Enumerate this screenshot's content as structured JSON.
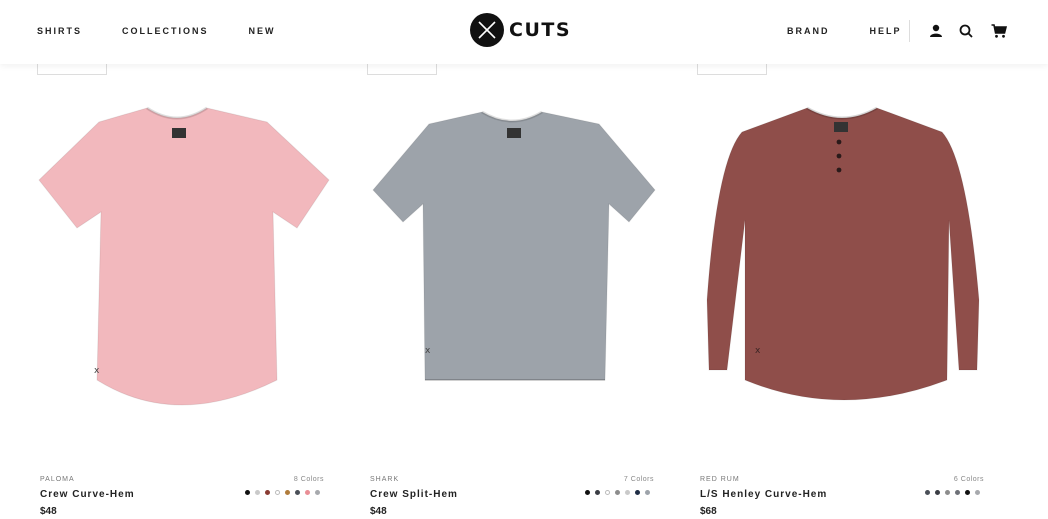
{
  "header": {
    "nav_left": [
      "SHIRTS",
      "COLLECTIONS",
      "NEW"
    ],
    "logo_text": "CUTS",
    "nav_right": [
      "BRAND",
      "HELP"
    ],
    "icons": [
      "account-icon",
      "search-icon",
      "cart-icon"
    ]
  },
  "products": [
    {
      "color_name": "PALOMA",
      "colors_count": "8 Colors",
      "name": "Crew Curve-Hem",
      "price": "$48",
      "shirt_color": "#f2b8bd",
      "style": "tee-curve",
      "swatches": [
        "#111111",
        "#c9c9c9",
        "#8a3b33",
        "#ffffff",
        "#b07c3c",
        "#4a4f57",
        "#e98e95",
        "#a7a9ad"
      ]
    },
    {
      "color_name": "SHARK",
      "colors_count": "7 Colors",
      "name": "Crew Split-Hem",
      "price": "$48",
      "shirt_color": "#9da3aa",
      "style": "tee-split",
      "swatches": [
        "#111111",
        "#3a3d44",
        "#ffffff",
        "#8c8c8c",
        "#c9c9c9",
        "#1f2d45",
        "#9da3aa"
      ]
    },
    {
      "color_name": "RED RUM",
      "colors_count": "6 Colors",
      "name": "L/S Henley Curve-Hem",
      "price": "$68",
      "shirt_color": "#8f4e4a",
      "style": "henley",
      "swatches": [
        "#4a4f57",
        "#3a3d44",
        "#8c8c8c",
        "#6d7077",
        "#111111",
        "#a7a9ad"
      ]
    }
  ]
}
